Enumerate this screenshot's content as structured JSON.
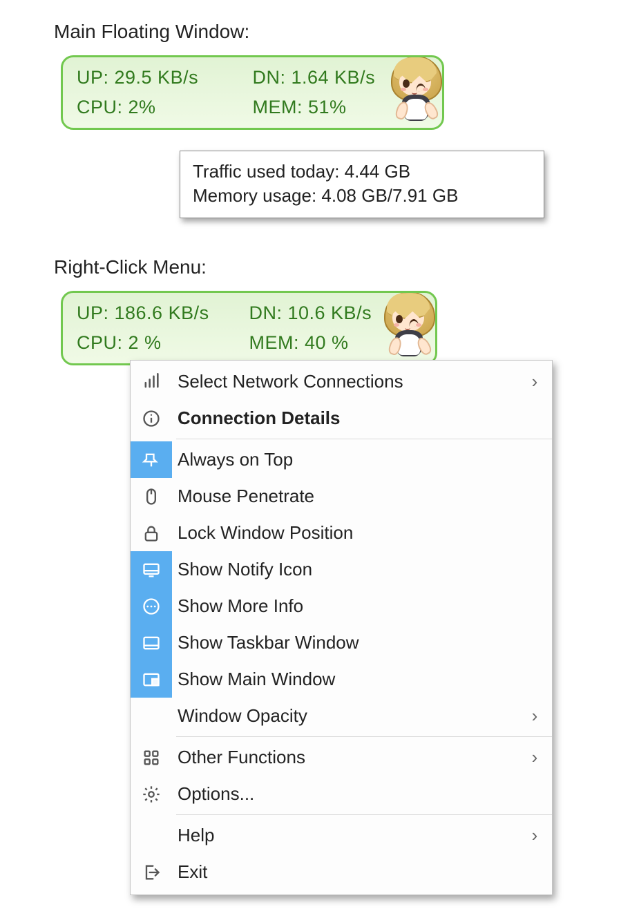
{
  "section1_title": "Main Floating Window:",
  "widget1": {
    "up": "UP: 29.5 KB/s",
    "dn": "DN: 1.64 KB/s",
    "cpu": "CPU: 2%",
    "mem": "MEM: 51%"
  },
  "tooltip": {
    "line1": "Traffic used today: 4.44 GB",
    "line2": "Memory usage: 4.08 GB/7.91 GB"
  },
  "section2_title": "Right-Click Menu:",
  "widget2": {
    "up": "UP: 186.6 KB/s",
    "dn": "DN: 10.6 KB/s",
    "cpu": "CPU: 2 %",
    "mem": "MEM: 40 %"
  },
  "menu": {
    "select_network": "Select Network Connections",
    "connection_details": "Connection Details",
    "always_on_top": "Always on Top",
    "mouse_penetrate": "Mouse Penetrate",
    "lock_window": "Lock Window Position",
    "show_notify": "Show Notify Icon",
    "show_more_info": "Show More Info",
    "show_taskbar": "Show Taskbar Window",
    "show_main_window": "Show Main Window",
    "window_opacity": "Window Opacity",
    "other_functions": "Other Functions",
    "options": "Options...",
    "help": "Help",
    "exit": "Exit"
  },
  "glyphs": {
    "submenu_arrow": "›"
  }
}
